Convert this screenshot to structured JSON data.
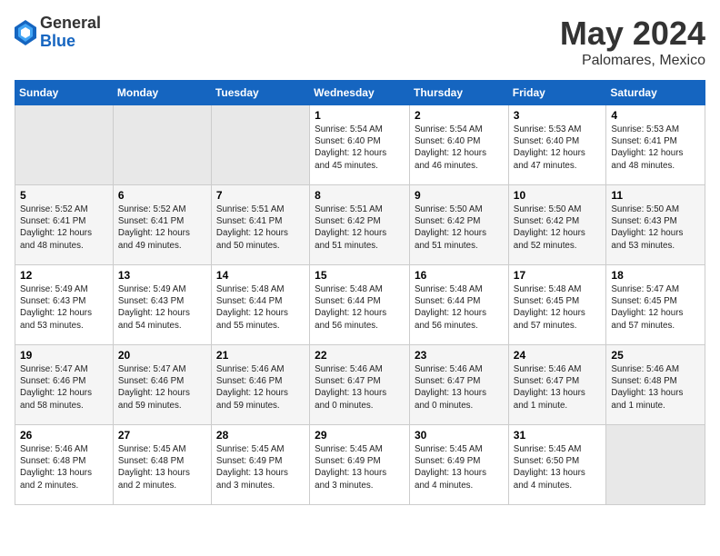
{
  "header": {
    "logo_general": "General",
    "logo_blue": "Blue",
    "month_year": "May 2024",
    "location": "Palomares, Mexico"
  },
  "columns": [
    "Sunday",
    "Monday",
    "Tuesday",
    "Wednesday",
    "Thursday",
    "Friday",
    "Saturday"
  ],
  "weeks": [
    [
      {
        "day": "",
        "info": ""
      },
      {
        "day": "",
        "info": ""
      },
      {
        "day": "",
        "info": ""
      },
      {
        "day": "1",
        "info": "Sunrise: 5:54 AM\nSunset: 6:40 PM\nDaylight: 12 hours\nand 45 minutes."
      },
      {
        "day": "2",
        "info": "Sunrise: 5:54 AM\nSunset: 6:40 PM\nDaylight: 12 hours\nand 46 minutes."
      },
      {
        "day": "3",
        "info": "Sunrise: 5:53 AM\nSunset: 6:40 PM\nDaylight: 12 hours\nand 47 minutes."
      },
      {
        "day": "4",
        "info": "Sunrise: 5:53 AM\nSunset: 6:41 PM\nDaylight: 12 hours\nand 48 minutes."
      }
    ],
    [
      {
        "day": "5",
        "info": "Sunrise: 5:52 AM\nSunset: 6:41 PM\nDaylight: 12 hours\nand 48 minutes."
      },
      {
        "day": "6",
        "info": "Sunrise: 5:52 AM\nSunset: 6:41 PM\nDaylight: 12 hours\nand 49 minutes."
      },
      {
        "day": "7",
        "info": "Sunrise: 5:51 AM\nSunset: 6:41 PM\nDaylight: 12 hours\nand 50 minutes."
      },
      {
        "day": "8",
        "info": "Sunrise: 5:51 AM\nSunset: 6:42 PM\nDaylight: 12 hours\nand 51 minutes."
      },
      {
        "day": "9",
        "info": "Sunrise: 5:50 AM\nSunset: 6:42 PM\nDaylight: 12 hours\nand 51 minutes."
      },
      {
        "day": "10",
        "info": "Sunrise: 5:50 AM\nSunset: 6:42 PM\nDaylight: 12 hours\nand 52 minutes."
      },
      {
        "day": "11",
        "info": "Sunrise: 5:50 AM\nSunset: 6:43 PM\nDaylight: 12 hours\nand 53 minutes."
      }
    ],
    [
      {
        "day": "12",
        "info": "Sunrise: 5:49 AM\nSunset: 6:43 PM\nDaylight: 12 hours\nand 53 minutes."
      },
      {
        "day": "13",
        "info": "Sunrise: 5:49 AM\nSunset: 6:43 PM\nDaylight: 12 hours\nand 54 minutes."
      },
      {
        "day": "14",
        "info": "Sunrise: 5:48 AM\nSunset: 6:44 PM\nDaylight: 12 hours\nand 55 minutes."
      },
      {
        "day": "15",
        "info": "Sunrise: 5:48 AM\nSunset: 6:44 PM\nDaylight: 12 hours\nand 56 minutes."
      },
      {
        "day": "16",
        "info": "Sunrise: 5:48 AM\nSunset: 6:44 PM\nDaylight: 12 hours\nand 56 minutes."
      },
      {
        "day": "17",
        "info": "Sunrise: 5:48 AM\nSunset: 6:45 PM\nDaylight: 12 hours\nand 57 minutes."
      },
      {
        "day": "18",
        "info": "Sunrise: 5:47 AM\nSunset: 6:45 PM\nDaylight: 12 hours\nand 57 minutes."
      }
    ],
    [
      {
        "day": "19",
        "info": "Sunrise: 5:47 AM\nSunset: 6:46 PM\nDaylight: 12 hours\nand 58 minutes."
      },
      {
        "day": "20",
        "info": "Sunrise: 5:47 AM\nSunset: 6:46 PM\nDaylight: 12 hours\nand 59 minutes."
      },
      {
        "day": "21",
        "info": "Sunrise: 5:46 AM\nSunset: 6:46 PM\nDaylight: 12 hours\nand 59 minutes."
      },
      {
        "day": "22",
        "info": "Sunrise: 5:46 AM\nSunset: 6:47 PM\nDaylight: 13 hours\nand 0 minutes."
      },
      {
        "day": "23",
        "info": "Sunrise: 5:46 AM\nSunset: 6:47 PM\nDaylight: 13 hours\nand 0 minutes."
      },
      {
        "day": "24",
        "info": "Sunrise: 5:46 AM\nSunset: 6:47 PM\nDaylight: 13 hours\nand 1 minute."
      },
      {
        "day": "25",
        "info": "Sunrise: 5:46 AM\nSunset: 6:48 PM\nDaylight: 13 hours\nand 1 minute."
      }
    ],
    [
      {
        "day": "26",
        "info": "Sunrise: 5:46 AM\nSunset: 6:48 PM\nDaylight: 13 hours\nand 2 minutes."
      },
      {
        "day": "27",
        "info": "Sunrise: 5:45 AM\nSunset: 6:48 PM\nDaylight: 13 hours\nand 2 minutes."
      },
      {
        "day": "28",
        "info": "Sunrise: 5:45 AM\nSunset: 6:49 PM\nDaylight: 13 hours\nand 3 minutes."
      },
      {
        "day": "29",
        "info": "Sunrise: 5:45 AM\nSunset: 6:49 PM\nDaylight: 13 hours\nand 3 minutes."
      },
      {
        "day": "30",
        "info": "Sunrise: 5:45 AM\nSunset: 6:49 PM\nDaylight: 13 hours\nand 4 minutes."
      },
      {
        "day": "31",
        "info": "Sunrise: 5:45 AM\nSunset: 6:50 PM\nDaylight: 13 hours\nand 4 minutes."
      },
      {
        "day": "",
        "info": ""
      }
    ]
  ]
}
